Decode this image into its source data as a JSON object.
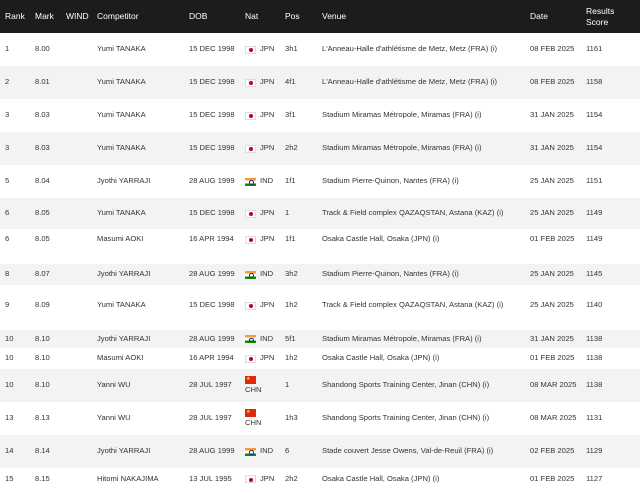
{
  "colors": {
    "jpn_red": "#bc002d",
    "ind_saffron": "#ff9933",
    "ind_green": "#138808",
    "chn_red": "#de2910",
    "header_bg": "#1c1c1c"
  },
  "headers": {
    "rank": "Rank",
    "mark": "Mark",
    "wind": "WIND",
    "competitor": "Competitor",
    "dob": "DOB",
    "nat": "Nat",
    "pos": "Pos",
    "venue": "Venue",
    "date": "Date",
    "score_line1": "Results",
    "score_line2": "Score"
  },
  "rows": [
    {
      "rank": "1",
      "mark": "8.00",
      "competitor": "Yumi TANAKA",
      "dob": "15 DEC 1998",
      "nat": "JPN",
      "flag": "jpn-flag-icon",
      "pos": "3h1",
      "venue": "L'Anneau-Halle d'athlétisme de Metz, Metz (FRA) (i)",
      "date": "08 FEB 2025",
      "score": "1161"
    },
    {
      "rank": "2",
      "mark": "8.01",
      "competitor": "Yumi TANAKA",
      "dob": "15 DEC 1998",
      "nat": "JPN",
      "flag": "jpn-flag-icon",
      "pos": "4f1",
      "venue": "L'Anneau-Halle d'athlétisme de Metz, Metz (FRA) (i)",
      "date": "08 FEB 2025",
      "score": "1158"
    },
    {
      "rank": "3",
      "mark": "8.03",
      "competitor": "Yumi TANAKA",
      "dob": "15 DEC 1998",
      "nat": "JPN",
      "flag": "jpn-flag-icon",
      "pos": "3f1",
      "venue": "Stadium Miramas Métropole, Miramas (FRA) (i)",
      "date": "31 JAN 2025",
      "score": "1154"
    },
    {
      "rank": "3",
      "mark": "8.03",
      "competitor": "Yumi TANAKA",
      "dob": "15 DEC 1998",
      "nat": "JPN",
      "flag": "jpn-flag-icon",
      "pos": "2h2",
      "venue": "Stadium Miramas Métropole, Miramas (FRA) (i)",
      "date": "31 JAN 2025",
      "score": "1154"
    },
    {
      "rank": "5",
      "mark": "8.04",
      "competitor": "Jyothi YARRAJI",
      "dob": "28 AUG 1999",
      "nat": "IND",
      "flag": "ind-flag-icon",
      "pos": "1f1",
      "venue": "Stadium Pierre-Quinon, Nantes (FRA) (i)",
      "date": "25 JAN 2025",
      "score": "1151"
    },
    {
      "rank": "6",
      "mark": "8.05",
      "competitor": "Yumi TANAKA",
      "dob": "15 DEC 1998",
      "nat": "JPN",
      "flag": "jpn-flag-icon",
      "pos": "1",
      "venue": "Track & Field complex QAZAQSTAN, Astana (KAZ) (i)",
      "date": "25 JAN 2025",
      "score": "1149"
    },
    {
      "rank": "6",
      "mark": "8.05",
      "competitor": "Masumi AOKI",
      "dob": "16 APR 1994",
      "nat": "JPN",
      "flag": "jpn-flag-icon",
      "pos": "1f1",
      "venue": "Osaka Castle Hall, Osaka (JPN) (i)",
      "date": "01 FEB 2025",
      "score": "1149"
    },
    {
      "rank": "8",
      "mark": "8.07",
      "competitor": "Jyothi YARRAJI",
      "dob": "28 AUG 1999",
      "nat": "IND",
      "flag": "ind-flag-icon",
      "pos": "3h2",
      "venue": "Stadium Pierre-Quinon, Nantes (FRA) (i)",
      "date": "25 JAN 2025",
      "score": "1145"
    },
    {
      "rank": "9",
      "mark": "8.09",
      "competitor": "Yumi TANAKA",
      "dob": "15 DEC 1998",
      "nat": "JPN",
      "flag": "jpn-flag-icon",
      "pos": "1h2",
      "venue": "Track & Field complex QAZAQSTAN, Astana (KAZ) (i)",
      "date": "25 JAN 2025",
      "score": "1140"
    },
    {
      "rank": "10",
      "mark": "8.10",
      "competitor": "Jyothi YARRAJI",
      "dob": "28 AUG 1999",
      "nat": "IND",
      "flag": "ind-flag-icon",
      "pos": "5f1",
      "venue": "Stadium Miramas Métropole, Miramas (FRA) (i)",
      "date": "31 JAN 2025",
      "score": "1138"
    },
    {
      "rank": "10",
      "mark": "8.10",
      "competitor": "Masumi AOKI",
      "dob": "16 APR 1994",
      "nat": "JPN",
      "flag": "jpn-flag-icon",
      "pos": "1h2",
      "venue": "Osaka Castle Hall, Osaka (JPN) (i)",
      "date": "01 FEB 2025",
      "score": "1138"
    },
    {
      "rank": "10",
      "mark": "8.10",
      "competitor": "Yanni WU",
      "dob": "28 JUL 1997",
      "nat": "CHN",
      "flag": "chn-flag-icon",
      "pos": "1",
      "venue": "Shandong Sports Training Center, Jinan (CHN) (i)",
      "date": "08 MAR 2025",
      "score": "1138"
    },
    {
      "rank": "13",
      "mark": "8.13",
      "competitor": "Yanni WU",
      "dob": "28 JUL 1997",
      "nat": "CHN",
      "flag": "chn-flag-icon",
      "pos": "1h3",
      "venue": "Shandong Sports Training Center, Jinan (CHN) (i)",
      "date": "08 MAR 2025",
      "score": "1131"
    },
    {
      "rank": "14",
      "mark": "8.14",
      "competitor": "Jyothi YARRAJI",
      "dob": "28 AUG 1999",
      "nat": "IND",
      "flag": "ind-flag-icon",
      "pos": "6",
      "venue": "Stade couvert Jesse Owens, Val-de-Reuil (FRA) (i)",
      "date": "02 FEB 2025",
      "score": "1129"
    },
    {
      "rank": "15",
      "mark": "8.15",
      "competitor": "Hitomi NAKAJIMA",
      "dob": "13 JUL 1995",
      "nat": "JPN",
      "flag": "jpn-flag-icon",
      "pos": "2h2",
      "venue": "Osaka Castle Hall, Osaka (JPN) (i)",
      "date": "01 FEB 2025",
      "score": "1127"
    }
  ]
}
